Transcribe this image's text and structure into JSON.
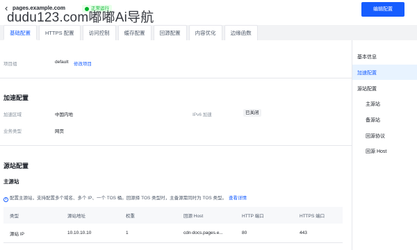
{
  "header": {
    "back_glyph": "‹",
    "domain": "pages.example.com",
    "status": "正常运行",
    "watermark": "dudu123.com嘟嘟Ai导航",
    "edit_button": "编辑配置"
  },
  "tabs": [
    {
      "label": "基础配置",
      "active": true
    },
    {
      "label": "HTTPS 配置",
      "active": false
    },
    {
      "label": "访问控制",
      "active": false
    },
    {
      "label": "缓存配置",
      "active": false
    },
    {
      "label": "回源配置",
      "active": false
    },
    {
      "label": "内容优化",
      "active": false
    },
    {
      "label": "边缘函数",
      "active": false
    }
  ],
  "basic": {
    "project_label": "项目组",
    "project_value": "default",
    "project_link": "修改项目"
  },
  "acceleration": {
    "title": "加速配置",
    "region_label": "加速区域",
    "region_value": "中国内地",
    "ipv6_label": "IPv6 加速",
    "ipv6_value": "已关闭",
    "biz_label": "业务类型",
    "biz_value": "网页"
  },
  "origin": {
    "title": "源站配置",
    "primary_title": "主源站",
    "notice": "配置主源站，支持配置多个域名、多个 IP、一个 TOS 桶。回源择 TOS 类型时，主备源需同时为 TOS 类型。",
    "notice_link": "查看详情",
    "table": {
      "headers": [
        "类型",
        "源站地址",
        "权重",
        "回源 Host",
        "HTTP 端口",
        "HTTPS 端口"
      ],
      "rows": [
        [
          "源站 IP",
          "10.10.10.10",
          "1",
          "cdn-docs.pages.e...",
          "80",
          "443"
        ]
      ]
    }
  },
  "sidenav": {
    "items": [
      {
        "label": "基本信息",
        "active": false
      },
      {
        "label": "加速配置",
        "active": true
      },
      {
        "label": "源站配置",
        "active": false
      },
      {
        "label": "主源站",
        "active": false
      },
      {
        "label": "备源站",
        "active": false
      },
      {
        "label": "回源协议",
        "active": false
      },
      {
        "label": "回源 Host",
        "active": false
      }
    ]
  },
  "colors": {
    "primary": "#165dff",
    "success": "#00b42a",
    "background": "#f2f3f5"
  }
}
